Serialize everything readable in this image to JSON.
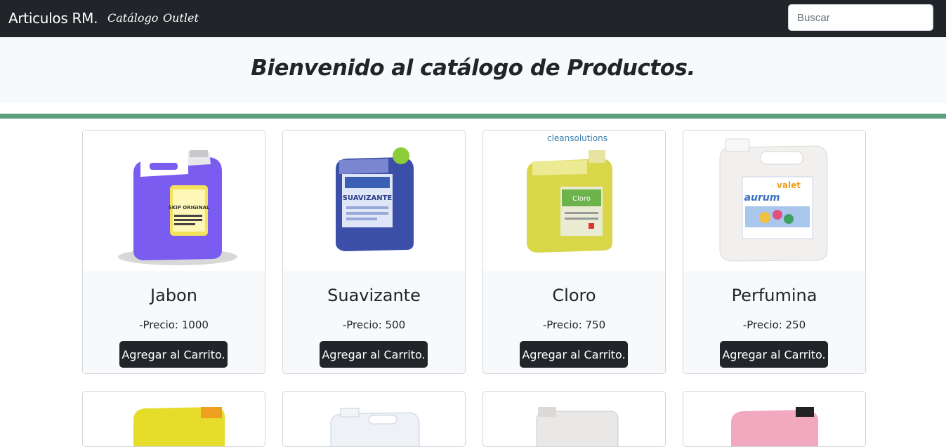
{
  "navbar": {
    "brand": "Articulos RM.",
    "links": [
      "Catálogo",
      "Outlet"
    ],
    "search_placeholder": "Buscar"
  },
  "hero": {
    "title": "Bienvenido al catálogo de Productos."
  },
  "colors": {
    "navbar_bg": "#212529",
    "divider": "#5a9e7d",
    "button_bg": "#212529"
  },
  "products": [
    {
      "name": "Jabon",
      "price": "-Precio: 1000",
      "button": "Agregar al Carrito.",
      "image_icon": "purple-detergent-jug",
      "label": "SKIP ORIGINAL"
    },
    {
      "name": "Suavizante",
      "price": "-Precio: 500",
      "button": "Agregar al Carrito.",
      "image_icon": "blue-softener-jug",
      "label": "SUAVIZANTE"
    },
    {
      "name": "Cloro",
      "price": "-Precio: 750",
      "button": "Agregar al Carrito.",
      "image_icon": "yellow-bleach-jug",
      "label": "Cloro",
      "brand": "cleansolutions"
    },
    {
      "name": "Perfumina",
      "price": "-Precio: 250",
      "button": "Agregar al Carrito.",
      "image_icon": "white-perfume-jug",
      "label": "aurum",
      "label2": "valet"
    }
  ],
  "second_row_icons": [
    "yellow-jug",
    "white-jug",
    "white-jug",
    "pink-jug"
  ]
}
